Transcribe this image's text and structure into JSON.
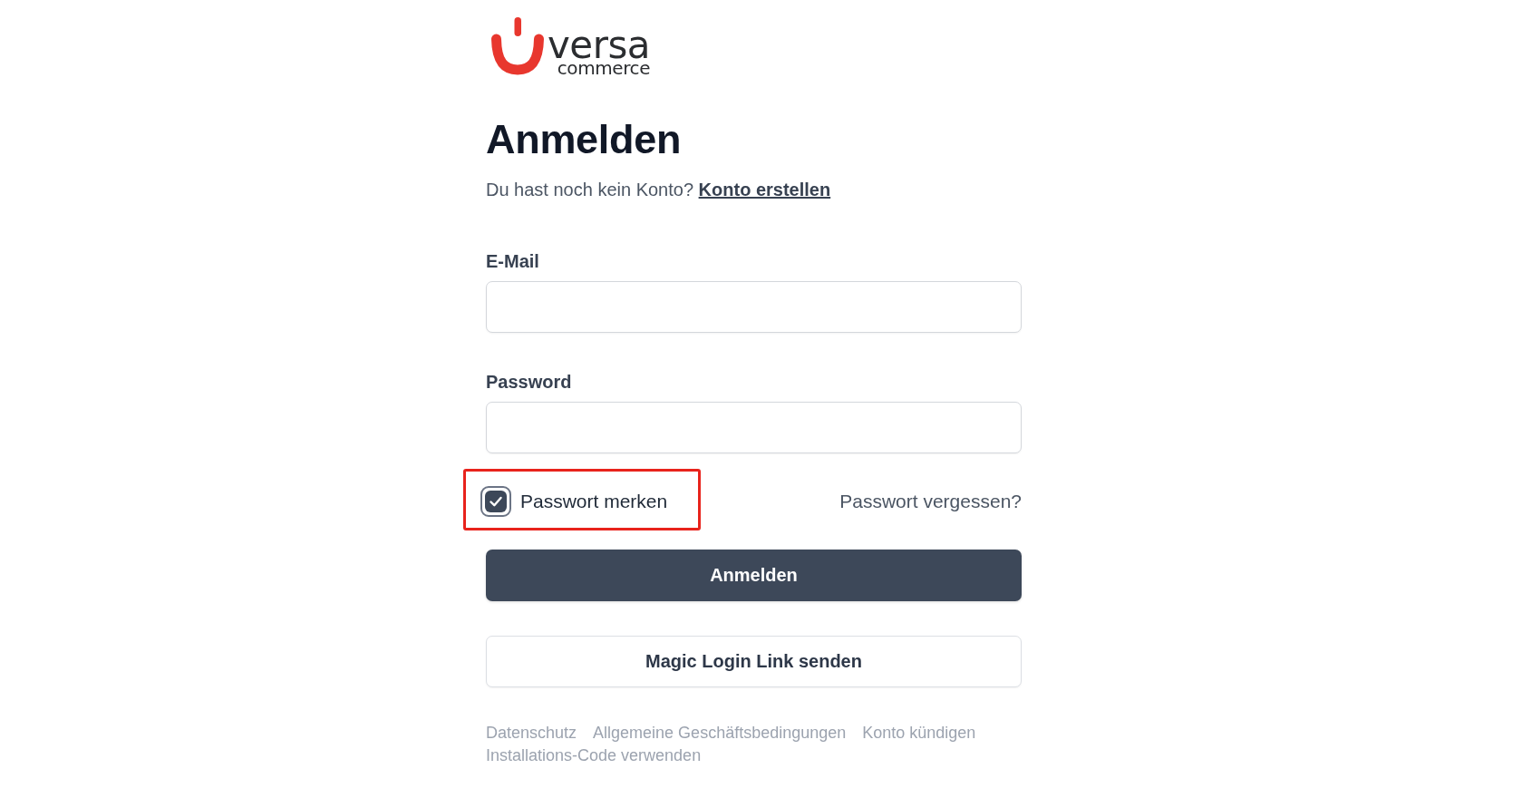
{
  "logo": {
    "wordmark": "versa",
    "tagline": "commerce"
  },
  "heading": "Anmelden",
  "signup_prompt": {
    "text": "Du hast noch kein Konto?",
    "link": "Konto erstellen"
  },
  "fields": [
    {
      "label": "E-Mail"
    },
    {
      "label": "Password"
    }
  ],
  "remember": {
    "label": "Passwort merken",
    "checked": true,
    "highlighted": true
  },
  "forgot_link": "Passwort vergessen?",
  "buttons": [
    {
      "label": "Anmelden",
      "kind": "primary"
    },
    {
      "label": "Magic Login Link senden",
      "kind": "secondary"
    }
  ],
  "footer_links": [
    "Datenschutz",
    "Allgemeine Geschäftsbedingungen",
    "Konto kündigen",
    "Installations-Code verwenden"
  ]
}
